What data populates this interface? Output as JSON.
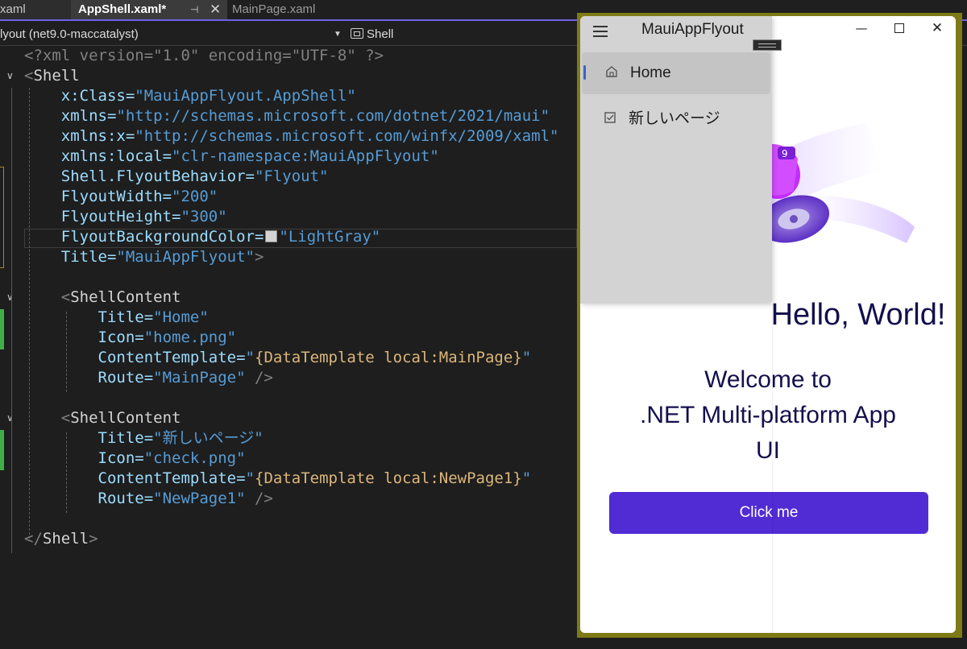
{
  "tabs": {
    "left_partial": "xaml",
    "active": "AppShell.xaml*",
    "active_pin": "⊣",
    "active_close": "✕",
    "other": "MainPage.xaml"
  },
  "navbar": {
    "project": "lyout (net9.0-maccatalyst)",
    "member": "Shell"
  },
  "code": [
    {
      "parts": [
        {
          "t": "<?xml version=\"1.0\" encoding=\"UTF-8\" ?>",
          "c": "c-gray"
        }
      ]
    },
    {
      "parts": [
        {
          "t": "<",
          "c": "c-gray"
        },
        {
          "t": "Shell",
          "c": "c-white"
        }
      ]
    },
    {
      "parts": [
        {
          "t": "    x:Class=",
          "c": "c-lblue"
        },
        {
          "t": "\"MauiAppFlyout.AppShell\"",
          "c": "c-str"
        }
      ]
    },
    {
      "parts": [
        {
          "t": "    xmlns=",
          "c": "c-lblue"
        },
        {
          "t": "\"http://schemas.microsoft.com/dotnet/2021/maui\"",
          "c": "c-str"
        }
      ]
    },
    {
      "parts": [
        {
          "t": "    xmlns:x=",
          "c": "c-lblue"
        },
        {
          "t": "\"http://schemas.microsoft.com/winfx/2009/xaml\"",
          "c": "c-str"
        }
      ]
    },
    {
      "parts": [
        {
          "t": "    xmlns:local=",
          "c": "c-lblue"
        },
        {
          "t": "\"clr-namespace:MauiAppFlyout\"",
          "c": "c-str"
        }
      ]
    },
    {
      "parts": [
        {
          "t": "    Shell.FlyoutBehavior=",
          "c": "c-lblue"
        },
        {
          "t": "\"Flyout\"",
          "c": "c-str"
        }
      ]
    },
    {
      "parts": [
        {
          "t": "    FlyoutWidth=",
          "c": "c-lblue"
        },
        {
          "t": "\"200\"",
          "c": "c-str"
        }
      ]
    },
    {
      "parts": [
        {
          "t": "    FlyoutHeight=",
          "c": "c-lblue"
        },
        {
          "t": "\"300\"",
          "c": "c-str"
        }
      ]
    },
    {
      "parts": [
        {
          "t": "    FlyoutBackgroundColor=",
          "c": "c-lblue"
        },
        {
          "t": "SWATCH",
          "c": "swatch"
        },
        {
          "t": "\"LightGray\"",
          "c": "c-str"
        }
      ]
    },
    {
      "parts": [
        {
          "t": "    Title=",
          "c": "c-lblue"
        },
        {
          "t": "\"MauiAppFlyout\"",
          "c": "c-str"
        },
        {
          "t": ">",
          "c": "c-gray"
        }
      ]
    },
    {
      "parts": []
    },
    {
      "parts": [
        {
          "t": "    <",
          "c": "c-gray"
        },
        {
          "t": "ShellContent",
          "c": "c-white"
        }
      ]
    },
    {
      "parts": [
        {
          "t": "        Title=",
          "c": "c-lblue"
        },
        {
          "t": "\"Home\"",
          "c": "c-str"
        }
      ]
    },
    {
      "parts": [
        {
          "t": "        Icon=",
          "c": "c-lblue"
        },
        {
          "t": "\"home.png\"",
          "c": "c-str"
        }
      ]
    },
    {
      "parts": [
        {
          "t": "        ContentTemplate=",
          "c": "c-lblue"
        },
        {
          "t": "\"",
          "c": "c-str"
        },
        {
          "t": "{DataTemplate local:MainPage}",
          "c": "c-bind"
        },
        {
          "t": "\"",
          "c": "c-str"
        }
      ]
    },
    {
      "parts": [
        {
          "t": "        Route=",
          "c": "c-lblue"
        },
        {
          "t": "\"MainPage\"",
          "c": "c-str"
        },
        {
          "t": " />",
          "c": "c-gray"
        }
      ]
    },
    {
      "parts": []
    },
    {
      "parts": [
        {
          "t": "    <",
          "c": "c-gray"
        },
        {
          "t": "ShellContent",
          "c": "c-white"
        }
      ]
    },
    {
      "parts": [
        {
          "t": "        Title=",
          "c": "c-lblue"
        },
        {
          "t": "\"新しいページ\"",
          "c": "c-str"
        }
      ]
    },
    {
      "parts": [
        {
          "t": "        Icon=",
          "c": "c-lblue"
        },
        {
          "t": "\"check.png\"",
          "c": "c-str"
        }
      ]
    },
    {
      "parts": [
        {
          "t": "        ContentTemplate=",
          "c": "c-lblue"
        },
        {
          "t": "\"",
          "c": "c-str"
        },
        {
          "t": "{DataTemplate local:NewPage1}",
          "c": "c-bind"
        },
        {
          "t": "\"",
          "c": "c-str"
        }
      ]
    },
    {
      "parts": [
        {
          "t": "        Route=",
          "c": "c-lblue"
        },
        {
          "t": "\"NewPage1\"",
          "c": "c-str"
        },
        {
          "t": " />",
          "c": "c-gray"
        }
      ]
    },
    {
      "parts": []
    },
    {
      "parts": [
        {
          "t": "</",
          "c": "c-gray"
        },
        {
          "t": "Shell",
          "c": "c-white"
        },
        {
          "t": ">",
          "c": "c-gray"
        }
      ]
    }
  ],
  "app": {
    "title": "MauiAppFlyout",
    "min_glyph": "—",
    "close_glyph": "✕",
    "flyout_items": [
      {
        "label": "Home",
        "icon": "home-icon",
        "selected": true
      },
      {
        "label": "新しいページ",
        "icon": "checkbox-icon",
        "selected": false
      }
    ],
    "hello": "Hello, World!",
    "welcome_lines": [
      "Welcome to",
      ".NET Multi-platform App",
      "UI"
    ],
    "button": "Click me"
  },
  "colors": {
    "accent": "#512bd4",
    "flyout_bg": "#d3d3d3",
    "window_border": "#7e7a16",
    "tab_underline": "#7160e8",
    "heading": "#140f4d"
  }
}
